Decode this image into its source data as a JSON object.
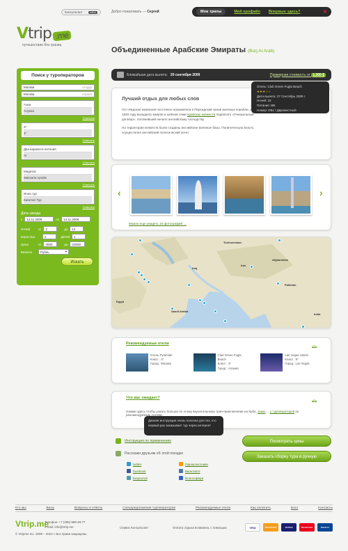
{
  "top": {
    "consultant": "Консультант",
    "chat": "online",
    "welcome_prefix": "Добро пожаловать —",
    "user": "Сергей",
    "nav": [
      "Мои трипы",
      "Мой профайл",
      "Впервые здесь?"
    ],
    "close": "✕"
  },
  "logo": {
    "v": "V",
    "trip": "trip",
    "me": ".me",
    "tagline": "путешествие без границ"
  },
  "page": {
    "title": "Объединенные Арабские Эмираты",
    "subtitle": "(Burj Al Arab)"
  },
  "sidebar": {
    "title": "Поиск у туроператоров",
    "from": "Москва",
    "from_hint": "откуда",
    "to": "Москва",
    "to_hint": "страна",
    "cities": [
      "Азиа",
      "Алупка"
    ],
    "stars": [
      "3*",
      "4*"
    ],
    "meals": [
      "Два варианта питания",
      "AI"
    ],
    "hotels": [
      "Magestic",
      "Massaria Apside"
    ],
    "operators": [
      "Инна тур",
      "Капитал Тур"
    ],
    "clear": "Очистить",
    "date_label": "Дата заезда",
    "date_from_label": "с",
    "date_from": "14.11.2009",
    "date_to_label": "по",
    "date_to": "14.11.2009",
    "nights_label": "Ночей",
    "from_label": "от",
    "nights_from": "2",
    "to_label": "до",
    "nights_to": "14",
    "adults_label": "Взрослых",
    "adults": "2",
    "kids_label": "Детей",
    "kids": "1",
    "price_label": "Цена",
    "price_from": "4000",
    "price_to": "23000",
    "currency_label": "Валюта",
    "currency": "Рубль",
    "search": "Искать"
  },
  "datebar": {
    "label": "Ближайшая дата вылета:",
    "date": "20 сентября 2009",
    "price_label": "Примерная стоимость от",
    "price": "1,300 $"
  },
  "tooltip": {
    "hotel": "Отель: Club Green Fugla Beach",
    "stars": "★★★☆☆",
    "date": "Дата вылета: 27 Сентябрь 2009 г.",
    "nights": "Ночей: 15",
    "meal": "Питание: BB",
    "room": "Номер: DBL \\ Двухместный"
  },
  "info": {
    "title": "Лучший отдых для любых слов",
    "p1a": "Ост-Индская компания постоянно направляла в Персидский залив военные корабли, и в 1820 году вынудила эмиров и шейхов семи",
    "p1link": "арабских княжеств",
    "p1b": "подписать «Генеральный договор», положивший начало английскому господству.",
    "p2": "На территории княжеств были созданы английские военные базы. Политическую власть осуществлял английский политический агент."
  },
  "gallery": {
    "more": "Можно еще увидеть 10 фотографий →",
    "prev": "‹",
    "next": "›"
  },
  "map": {
    "labels": [
      "Turkmenistan",
      "Iraq",
      "Iran",
      "Afghanistan",
      "Pakistan",
      "Saudi Arabia",
      "Egypt",
      "India"
    ]
  },
  "hotels": {
    "title": "Рекомендуемые отели",
    "items": [
      {
        "name": "Отель Pyramide",
        "class": "Класс : 4*",
        "city": "Город : Москва"
      },
      {
        "name": "Club Green Fugla Beach",
        "class": "Класс : 4*",
        "city": "Город : Алания"
      },
      {
        "name": "Las Vegas Hotels",
        "class": "Класс : 5*",
        "city": "Город : Las Vegas"
      }
    ]
  },
  "expect": {
    "title": "Что вас ожидает?",
    "text_a": "Нажми здесь чтобы узнать больше по этому вкусительному трип-приключение на Кубе,",
    "text_link1": "заказ",
    "text_link2": "у туроператоров",
    "text_b": "по рекомендуемым отелям."
  },
  "hint": {
    "text": "Данная инструкция очень полезна для тех, кто первый раз заказывает тур через интернет"
  },
  "instr": {
    "label": "Инструкция по применению"
  },
  "tell": {
    "label": "Расскажи друзьям об этой поездке"
  },
  "social": [
    "twitter",
    "Одноклассники",
    "facebook",
    "Вконтакте",
    "livejournal",
    "Блогосфера"
  ],
  "buttons": {
    "prices": "Посмотреть цены",
    "order": "Заказать сборку тура в ручную"
  },
  "footer": {
    "nav": [
      "Кто мы",
      "Визы",
      "Вопросы и ответы",
      "Спецпредложения туроператоров",
      "Рекомендуемые отели",
      "Как оплатить",
      "Блог",
      "Контакты"
    ],
    "logo": "Vtrip.me",
    "phone": "Телефон: +7 (495) 989-48-77",
    "email": "e-mail: info@vtrip.me",
    "copy": "© Vtripme Inc. 2009 – 2010 г. Все права защищены.",
    "service": "Сервис Консультант",
    "payment": "Оплата отдыха возможна, с помощью:",
    "cards": [
      "VISA",
      "MasterCard",
      "Verified",
      "MasterCard",
      "Electron"
    ]
  }
}
